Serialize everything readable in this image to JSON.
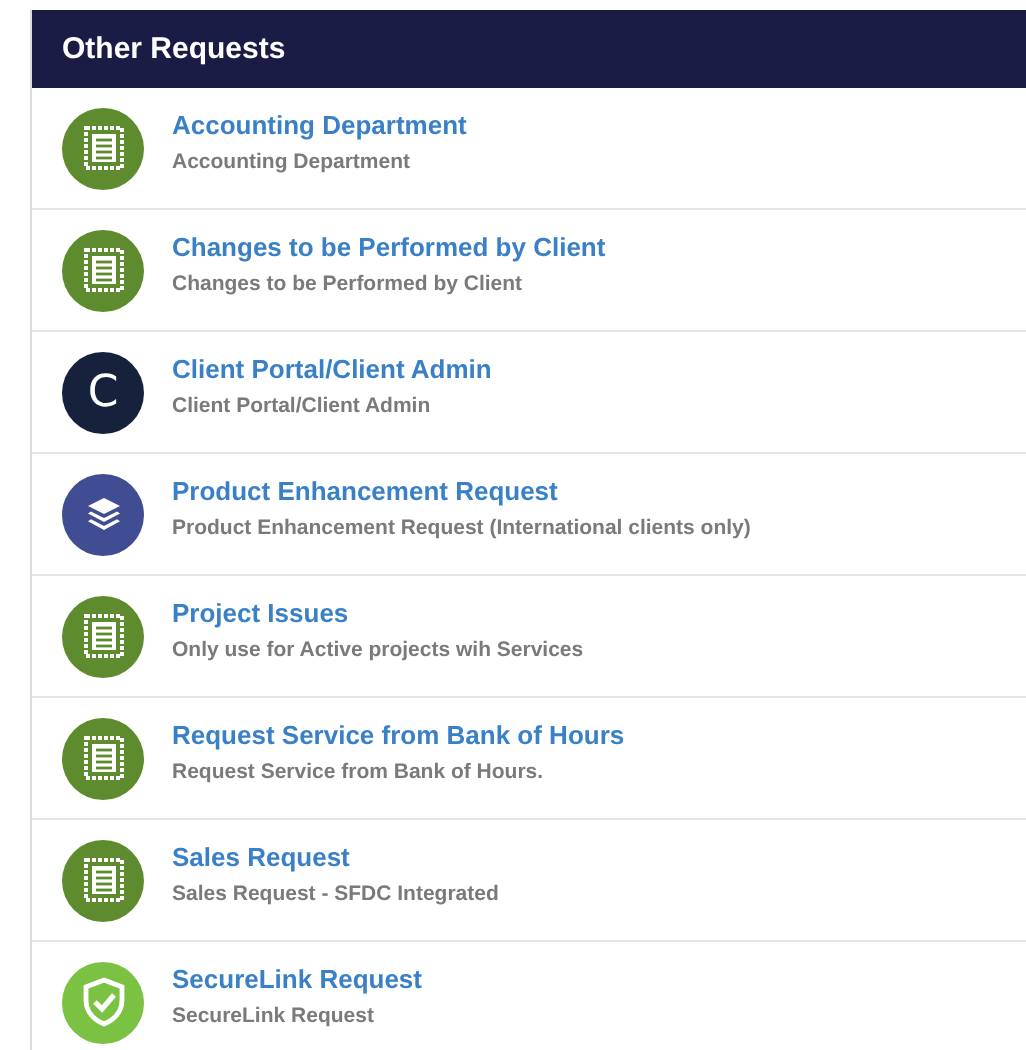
{
  "panel": {
    "title": "Other Requests"
  },
  "requests": [
    {
      "kind": "document",
      "color": "#5f8b2f",
      "title": "Accounting Department",
      "description": "Accounting Department"
    },
    {
      "kind": "document",
      "color": "#5f8b2f",
      "title": "Changes to be Performed by Client",
      "description": "Changes to be Performed by Client"
    },
    {
      "kind": "letter",
      "color": "#16213b",
      "letter": "C",
      "title": "Client Portal/Client Admin",
      "description": "Client Portal/Client Admin"
    },
    {
      "kind": "layers",
      "color": "#414d93",
      "title": "Product Enhancement Request",
      "description": "Product Enhancement Request (International clients only)"
    },
    {
      "kind": "document",
      "color": "#5f8b2f",
      "title": "Project Issues",
      "description": "Only use for Active projects wih Services"
    },
    {
      "kind": "document",
      "color": "#5f8b2f",
      "title": "Request Service from Bank of Hours",
      "description": "Request Service from Bank of Hours."
    },
    {
      "kind": "document",
      "color": "#5f8b2f",
      "title": "Sales Request",
      "description": "Sales Request - SFDC Integrated"
    },
    {
      "kind": "shield",
      "color": "#7cc242",
      "title": "SecureLink Request",
      "description": "SecureLink Request"
    }
  ]
}
